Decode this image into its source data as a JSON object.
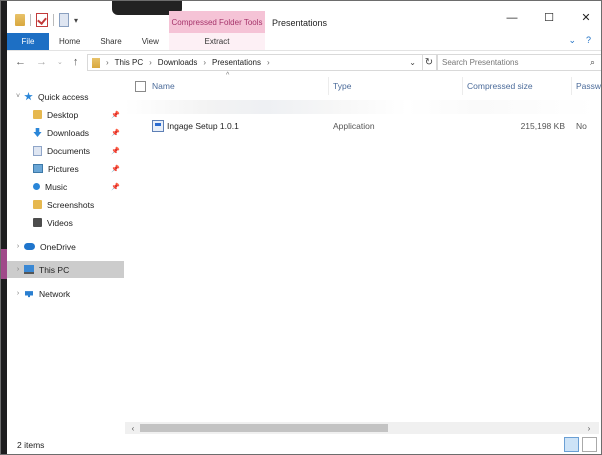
{
  "window": {
    "title": "Presentations",
    "context_tab": "Compressed Folder Tools",
    "controls": [
      "—",
      "☐",
      "✕"
    ]
  },
  "ribbon": {
    "tabs": [
      "File",
      "Home",
      "Share",
      "View"
    ],
    "context_sub_tab": "Extract"
  },
  "address": {
    "crumbs": [
      "This PC",
      "Downloads",
      "Presentations"
    ],
    "search_placeholder": "Search Presentations"
  },
  "nav_pane": {
    "quick_access": "Quick access",
    "items": [
      {
        "label": "Desktop",
        "icon": "folder-icon",
        "pinned": true
      },
      {
        "label": "Downloads",
        "icon": "download-icon",
        "pinned": true
      },
      {
        "label": "Documents",
        "icon": "document-icon",
        "pinned": true
      },
      {
        "label": "Pictures",
        "icon": "picture-icon",
        "pinned": true
      },
      {
        "label": "Music",
        "icon": "music-icon",
        "pinned": true
      },
      {
        "label": "Screenshots",
        "icon": "folder-icon",
        "pinned": false
      },
      {
        "label": "Videos",
        "icon": "video-icon",
        "pinned": false
      }
    ],
    "onedrive": "OneDrive",
    "this_pc": "This PC",
    "network": "Network"
  },
  "columns": {
    "name": "Name",
    "type": "Type",
    "compressed_size": "Compressed size",
    "password": "Passw"
  },
  "files": [
    {
      "name": "Ingage Setup 1.0.1",
      "type": "Application",
      "compressed_size": "215,198 KB",
      "password": "No"
    }
  ],
  "status": {
    "item_count": "2 items"
  },
  "colors": {
    "file_tab": "#1d6fc4",
    "context_tab_bg": "#f5c3d6",
    "context_tab_text": "#a5336a",
    "selected_nav": "#cccccc"
  }
}
